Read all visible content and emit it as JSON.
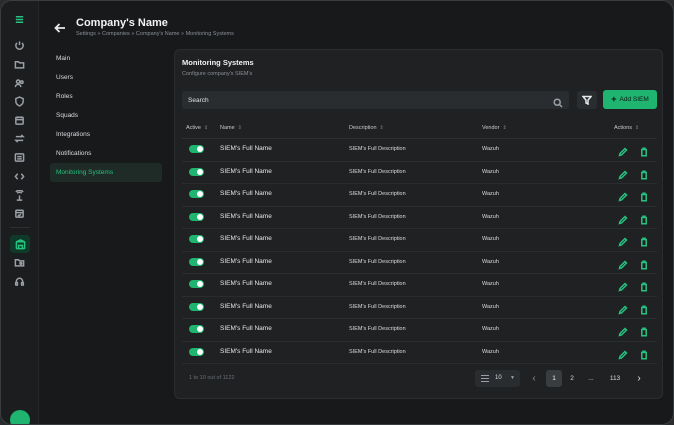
{
  "header": {
    "title": "Company's Name",
    "breadcrumb": "Settings » Companies » Company's Name » Monitoring Systems"
  },
  "sidebar": {
    "items": [
      {
        "label": "Main"
      },
      {
        "label": "Users"
      },
      {
        "label": "Roles"
      },
      {
        "label": "Squads"
      },
      {
        "label": "Integrations"
      },
      {
        "label": "Notifications"
      },
      {
        "label": "Monitoring Systems",
        "active": true
      }
    ]
  },
  "panel": {
    "title": "Monitoring Systems",
    "subtitle": "Configure company's SIEM's",
    "search_placeholder": "Search",
    "add_label": "Add SIEM"
  },
  "table": {
    "columns": [
      "Active",
      "Name",
      "Description",
      "Vendor",
      "Actions"
    ],
    "rows": [
      {
        "active": true,
        "name": "SIEM's Full Name",
        "description": "SIEM's Full Description",
        "vendor": "Wazuh"
      },
      {
        "active": true,
        "name": "SIEM's Full Name",
        "description": "SIEM's Full Description",
        "vendor": "Wazuh"
      },
      {
        "active": true,
        "name": "SIEM's Full Name",
        "description": "SIEM's Full Description",
        "vendor": "Wazuh"
      },
      {
        "active": true,
        "name": "SIEM's Full Name",
        "description": "SIEM's Full Description",
        "vendor": "Wazuh"
      },
      {
        "active": true,
        "name": "SIEM's Full Name",
        "description": "SIEM's Full Description",
        "vendor": "Wazuh"
      },
      {
        "active": true,
        "name": "SIEM's Full Name",
        "description": "SIEM's Full Description",
        "vendor": "Wazuh"
      },
      {
        "active": true,
        "name": "SIEM's Full Name",
        "description": "SIEM's Full Description",
        "vendor": "Wazuh"
      },
      {
        "active": true,
        "name": "SIEM's Full Name",
        "description": "SIEM's Full Description",
        "vendor": "Wazuh"
      },
      {
        "active": true,
        "name": "SIEM's Full Name",
        "description": "SIEM's Full Description",
        "vendor": "Wazuh"
      },
      {
        "active": true,
        "name": "SIEM's Full Name",
        "description": "SIEM's Full Description",
        "vendor": "Wazuh"
      }
    ]
  },
  "pagination": {
    "range_text": "1 to 10 out of 1122",
    "per_page": "10",
    "pages": [
      "1",
      "2",
      "...",
      "113"
    ],
    "current_page": "1"
  },
  "colors": {
    "accent": "#1fb46f",
    "background": "#17191b",
    "panel": "#1f2123"
  },
  "icons": {
    "rail": [
      "menu-icon",
      "power-icon",
      "folder-icon",
      "users-icon",
      "shield-icon",
      "calendar-icon",
      "transfer-icon",
      "list-icon",
      "code-icon",
      "antenna-icon",
      "calendar-check-icon",
      "company-icon",
      "folder-user-icon",
      "support-icon"
    ]
  }
}
